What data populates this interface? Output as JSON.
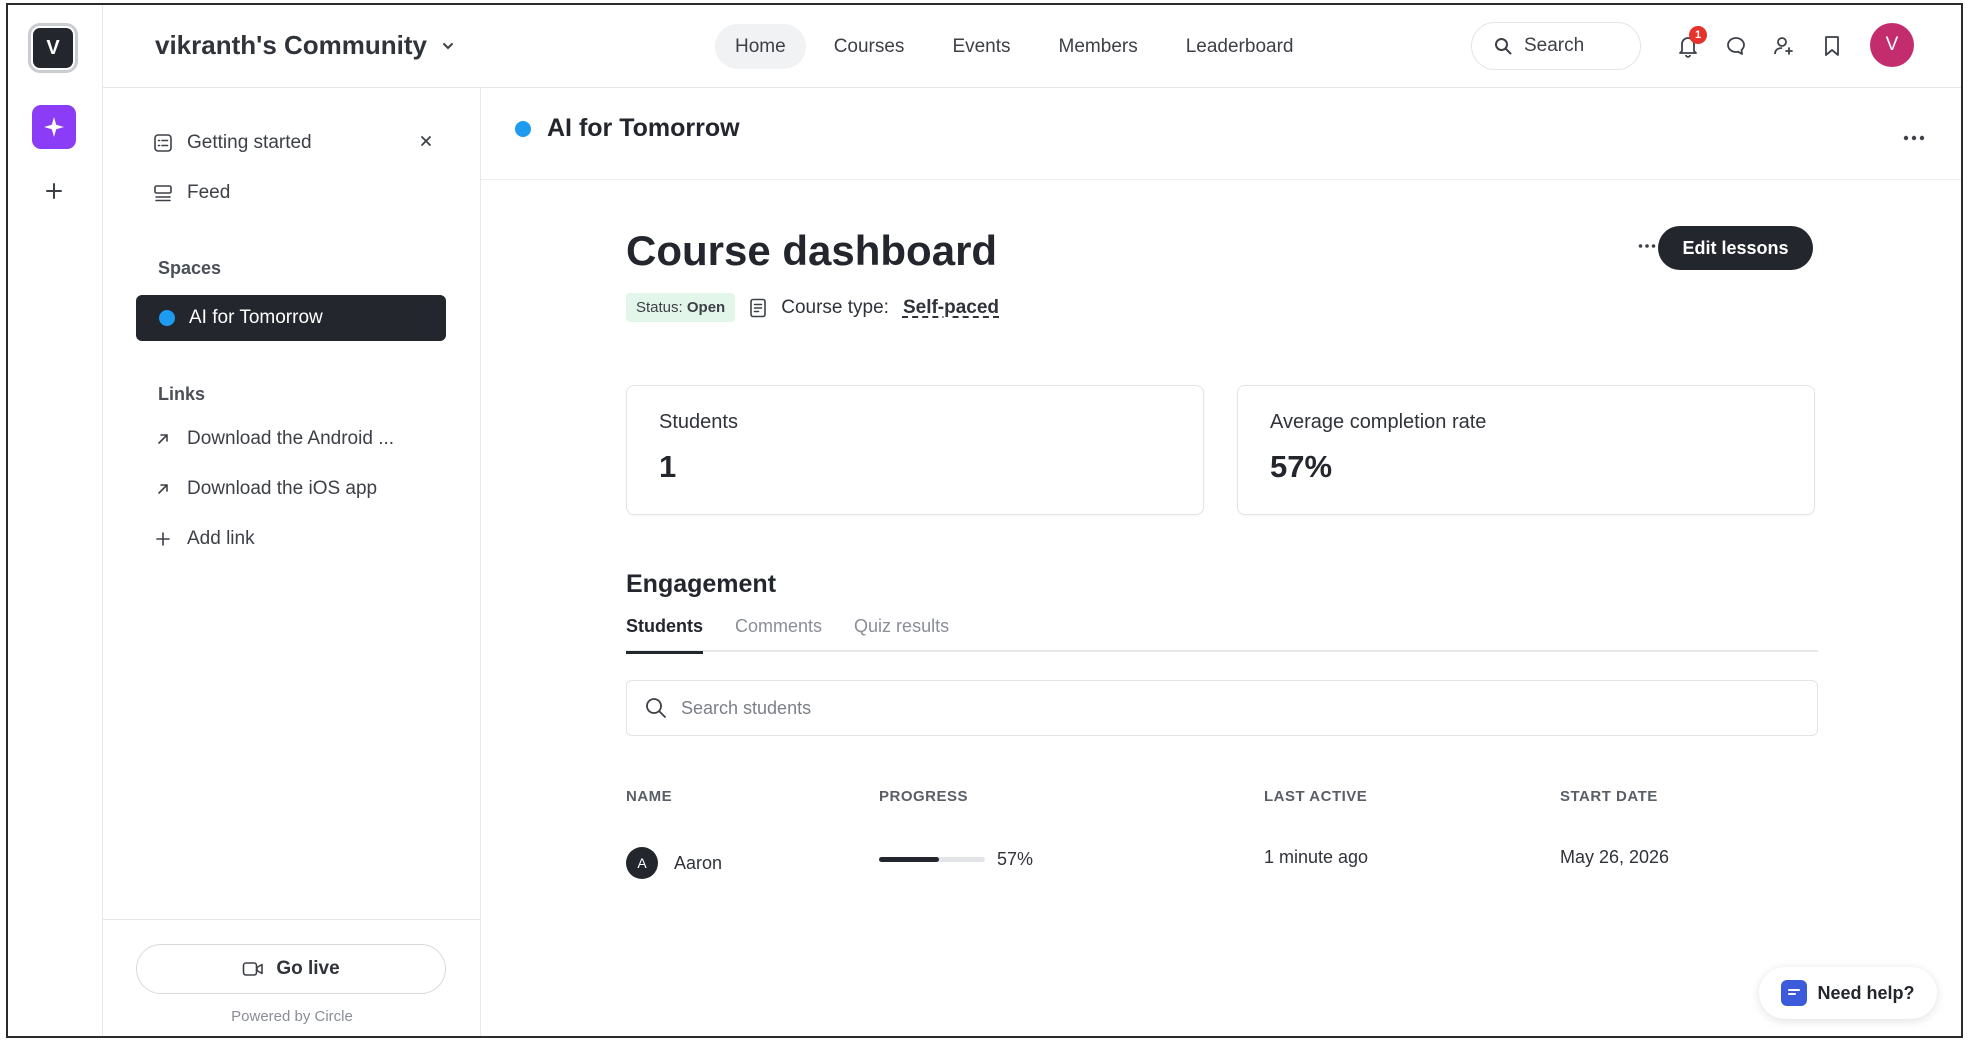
{
  "rail": {
    "logo_letter": "V"
  },
  "header": {
    "community_name": "vikranth's Community",
    "nav": [
      "Home",
      "Courses",
      "Events",
      "Members",
      "Leaderboard"
    ],
    "search_label": "Search",
    "notification_count": "1",
    "avatar_letter": "V"
  },
  "sidebar": {
    "getting_started": "Getting started",
    "feed": "Feed",
    "spaces_heading": "Spaces",
    "active_space": "AI for Tomorrow",
    "links_heading": "Links",
    "links": [
      "Download the Android ...",
      "Download the iOS app"
    ],
    "add_link": "Add link",
    "go_live": "Go live",
    "powered_by": "Powered by Circle"
  },
  "main": {
    "space_title": "AI for Tomorrow",
    "page_title": "Course dashboard",
    "edit_button": "Edit lessons",
    "status_label": "Status:",
    "status_value": "Open",
    "course_type_label": "Course type:",
    "course_type_value": "Self-paced",
    "cards": [
      {
        "label": "Students",
        "value": "1"
      },
      {
        "label": "Average completion rate",
        "value": "57%"
      }
    ],
    "engagement_title": "Engagement",
    "tabs": [
      "Students",
      "Comments",
      "Quiz results"
    ],
    "search_placeholder": "Search students",
    "columns": [
      "NAME",
      "PROGRESS",
      "LAST ACTIVE",
      "START DATE"
    ],
    "rows": [
      {
        "avatar": "A",
        "name": "Aaron",
        "progress": 0.57,
        "progress_label": "57%",
        "last_active": "1 minute ago",
        "start_date": "May 26, 2026"
      }
    ]
  },
  "help": {
    "label": "Need help?"
  },
  "colors": {
    "accent_purple": "#8b3cf7",
    "space_dot": "#1d9bf0",
    "avatar_pink": "#c32d6e",
    "status_green_bg": "#e3f6ea",
    "dark": "#23262d"
  }
}
